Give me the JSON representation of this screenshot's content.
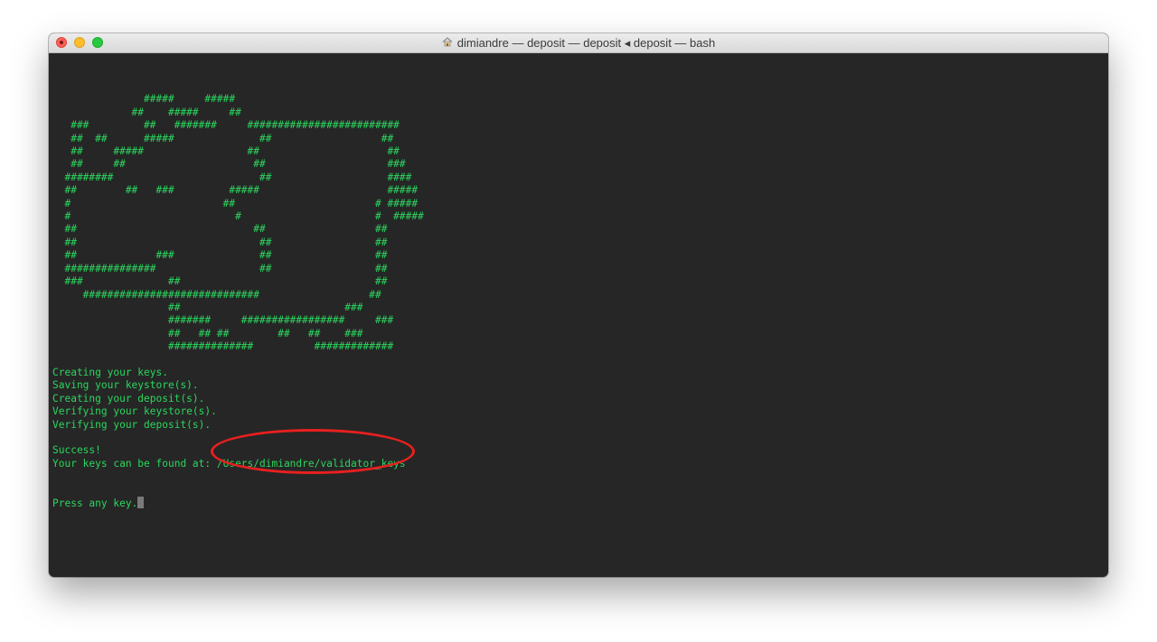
{
  "window": {
    "title": "dimiandre — deposit — deposit ◂ deposit — bash",
    "title_icon": "home-icon"
  },
  "terminal": {
    "ascii_art": "\n               #####     #####\n             ##    #####     ##\n   ###         ##   #######     #########################\n   ##  ##      #####              ##                  ##\n   ##     #####                 ##                     ##\n   ##     ##                     ##                    ###\n  ########                        ##                   ####\n  ##        ##   ###         #####                     #####\n  #                         ##                       # #####\n  #                           #                      #  #####\n  ##                             ##                  ##\n  ##                              ##                 ##\n  ##             ###              ##                 ##\n  ###############                 ##                 ##\n  ###              ##                                ##\n     #############################                  ##\n                   ##                           ###\n                   #######     #################     ###\n                   ##   ## ##        ##   ##    ###\n                   ##############          #############",
    "lines": [
      "Creating your keys.",
      "Saving your keystore(s).",
      "Creating your deposit(s).",
      "Verifying your keystore(s).",
      "Verifying your deposit(s)."
    ],
    "success": "Success!",
    "keys_prefix": "Your keys can be found at: ",
    "keys_path": "/Users/dimiandre/validator_keys",
    "prompt": "Press any key."
  },
  "colors": {
    "text": "#2bd65e",
    "background": "#262626",
    "highlight": "#e8201e"
  }
}
